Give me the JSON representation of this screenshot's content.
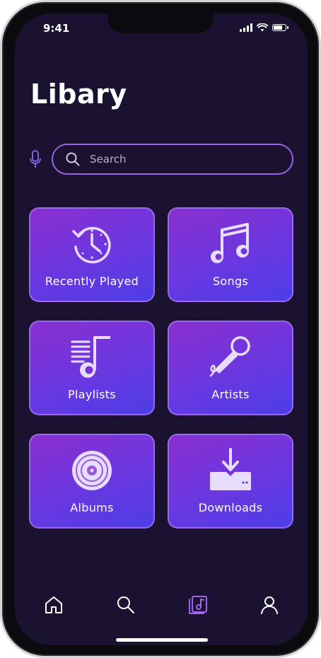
{
  "status": {
    "time": "9:41"
  },
  "page": {
    "title": "Libary"
  },
  "search": {
    "placeholder": "Search"
  },
  "tiles": [
    {
      "label": "Recently Played",
      "icon": "history-clock-icon"
    },
    {
      "label": "Songs",
      "icon": "music-notes-icon"
    },
    {
      "label": "Playlists",
      "icon": "playlist-icon"
    },
    {
      "label": "Artists",
      "icon": "microphone-icon"
    },
    {
      "label": "Albums",
      "icon": "vinyl-disc-icon"
    },
    {
      "label": "Downloads",
      "icon": "download-tray-icon"
    }
  ],
  "nav": [
    {
      "icon": "home-icon",
      "active": false
    },
    {
      "icon": "search-icon",
      "active": false
    },
    {
      "icon": "library-icon",
      "active": true
    },
    {
      "icon": "profile-icon",
      "active": false
    }
  ],
  "colors": {
    "background": "#1b1130",
    "accent": "#9c61e8",
    "tile_gradient_start": "#8a2fd0",
    "tile_gradient_end": "#4d3ee6",
    "icon_light": "#e7ddff"
  }
}
